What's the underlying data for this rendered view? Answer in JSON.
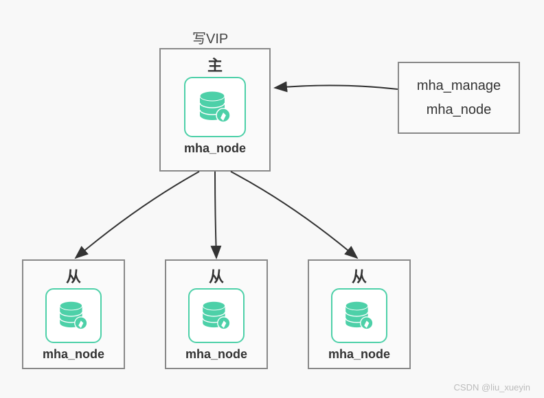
{
  "vip_label": "写VIP",
  "master": {
    "title": "主",
    "label": "mha_node"
  },
  "manager": {
    "line1": "mha_manage",
    "line2": "mha_node"
  },
  "slaves": {
    "title": "从",
    "label": "mha_node"
  },
  "watermark": "CSDN @liu_xueyin"
}
